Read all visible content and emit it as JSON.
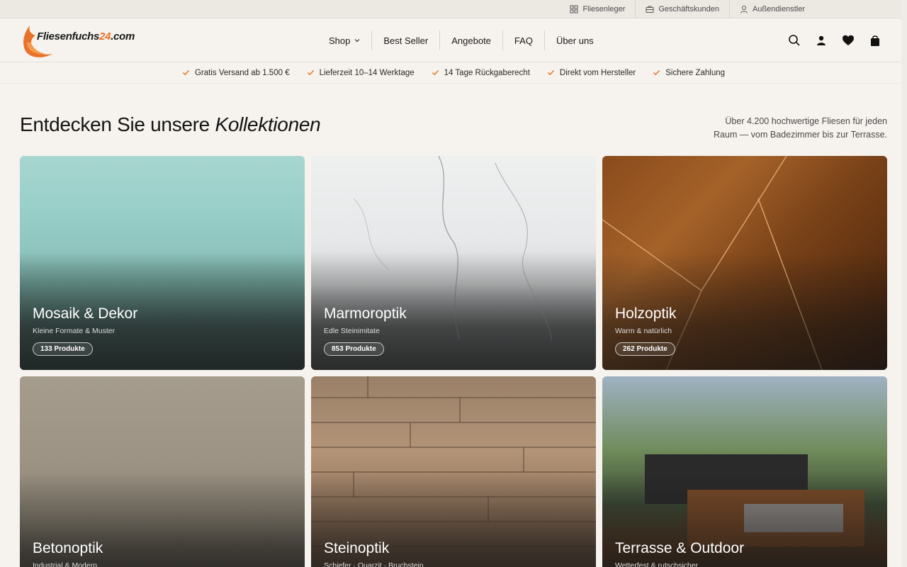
{
  "topbar": {
    "items": [
      {
        "label": "Fliesenleger",
        "icon": "grid-icon"
      },
      {
        "label": "Geschäftskunden",
        "icon": "briefcase-icon"
      },
      {
        "label": "Außendienstler",
        "icon": "person-icon"
      }
    ]
  },
  "logo": {
    "text": "Fliesenfuchs",
    "accent": "24",
    "suffix": ".com"
  },
  "nav": [
    {
      "label": "Shop"
    },
    {
      "label": "Best Seller"
    },
    {
      "label": "Angebote"
    },
    {
      "label": "FAQ"
    },
    {
      "label": "Über uns"
    }
  ],
  "header_icons": [
    "search-icon",
    "account-icon",
    "heart-icon",
    "bag-icon"
  ],
  "usps": [
    "Gratis Versand ab 1.500 €",
    "Lieferzeit 10–14 Werktage",
    "14 Tage Rückgaberecht",
    "Direkt vom Hersteller",
    "Sichere Zahlung"
  ],
  "section": {
    "title_plain": "Entdecken Sie unsere ",
    "title_em": "Kollektionen",
    "subtitle": "Über 4.200 hochwertige Fliesen für jeden Raum — vom Badezimmer bis zur Terrasse."
  },
  "collections": [
    {
      "title": "Mosaik & Dekor",
      "sub": "Kleine Formate & Muster",
      "badge": "133 Produkte"
    },
    {
      "title": "Marmoroptik",
      "sub": "Edle Steinimitate",
      "badge": "853 Produkte"
    },
    {
      "title": "Holzoptik",
      "sub": "Warm & natürlich",
      "badge": "262 Produkte"
    },
    {
      "title": "Betonoptik",
      "sub": "Industrial & Modern",
      "badge": ""
    },
    {
      "title": "Steinoptik",
      "sub": "Schiefer · Quarzit · Bruchstein",
      "badge": ""
    },
    {
      "title": "Terrasse & Outdoor",
      "sub": "Wetterfest & rutschsicher",
      "badge": ""
    }
  ],
  "colors": {
    "accent": "#e8722a",
    "background": "#f6f3ee"
  }
}
